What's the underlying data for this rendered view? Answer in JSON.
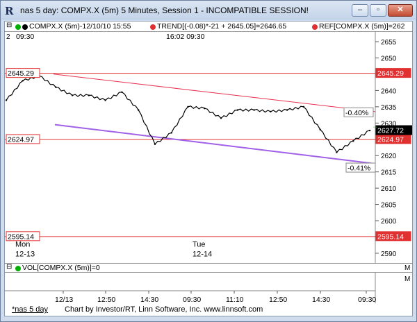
{
  "window": {
    "title": "nas 5 day: COMPX.X (5m) 5 Minutes, Session 1 - INCOMPATIBLE SESSION!",
    "app_icon_glyph": "R",
    "minimize_glyph": "–",
    "maximize_glyph": "▫",
    "close_glyph": "✕"
  },
  "legend": {
    "symbol": "COMPX.X (5m)-12/10/10 15:55",
    "trend": "TREND[(-0.08)*-21 + 2645.05]=2646.65",
    "ref": "REF[COMPX.X (5m)]=262"
  },
  "top_time_labels": {
    "left_num": "2",
    "left_time": "09:30",
    "mid": "16:02  09:30"
  },
  "day_labels": {
    "mon": "Mon",
    "mon_date": "12-13",
    "tue": "Tue",
    "tue_date": "12-14"
  },
  "price_axis": [
    "2655",
    "2650",
    "2645",
    "2640",
    "2635",
    "2630",
    "2625",
    "2620",
    "2615",
    "2610",
    "2605",
    "2600",
    "2595",
    "2590"
  ],
  "levels": {
    "upper": "2645.29",
    "middle": "2624.97",
    "lower": "2595.14",
    "current": "2627.72",
    "pct_top": "-0.40%",
    "pct_bottom": "-0.41%"
  },
  "volume": {
    "label": "VOL[COMPX.X (5m)]=0",
    "scale_label": "M"
  },
  "chart_scale_label": "M",
  "time_axis": [
    "12/13",
    "12:50",
    "14:30",
    "09:30",
    "11:10",
    "12:50",
    "14:30",
    "09:30"
  ],
  "footer": {
    "tab": "*nas 5 day",
    "credit": "Chart by Investor/RT, Linn Software, Inc. www.linnsoft.com"
  },
  "colors": {
    "level_line": "#e03030",
    "trend_line": "#e83050",
    "purple_line": "#a060e8",
    "price": "#000000",
    "current_bg": "#000000"
  },
  "chart_data": {
    "type": "line",
    "title": "COMPX.X (5m)",
    "ylim": [
      2587,
      2658
    ],
    "x_categories": [
      "12/13",
      "12:50",
      "14:30",
      "09:30",
      "11:10",
      "12:50",
      "14:30",
      "09:30"
    ],
    "series": [
      {
        "name": "COMPX.X (5m)",
        "x": [
          "12/13 09:30",
          "12/13 10:15",
          "12/13 11:00",
          "12/13 12:00",
          "12/13 13:00",
          "12/13 14:00",
          "12/13 14:40",
          "12/13 15:20",
          "12/13 15:55",
          "12/14 09:30",
          "12/14 10:00",
          "12/14 10:40",
          "12/14 11:20",
          "12/14 12:00",
          "12/14 12:40",
          "12/14 13:20",
          "12/14 14:00",
          "12/14 14:40",
          "12/14 15:20",
          "12/14 15:55",
          "12/15 09:30",
          "12/15 09:45",
          "12/15 10:00"
        ],
        "values": [
          2637,
          2643,
          2644.5,
          2641,
          2638.5,
          2638.5,
          2637,
          2639.5,
          2634,
          2623.5,
          2627,
          2635,
          2634.5,
          2631.5,
          2634,
          2634,
          2633.5,
          2634,
          2635,
          2628,
          2621,
          2624.5,
          2627.7
        ]
      },
      {
        "name": "TREND",
        "x": [
          "12/13 09:30",
          "12/15 10:00"
        ],
        "values": [
          2645.05,
          2633.5
        ]
      },
      {
        "name": "",
        "x": [
          "12/13 09:30",
          "12/15 10:00"
        ],
        "values": [
          2629.5,
          2617.5
        ]
      }
    ],
    "reference_lines": [
      2645.29,
      2624.97,
      2595.14
    ]
  }
}
